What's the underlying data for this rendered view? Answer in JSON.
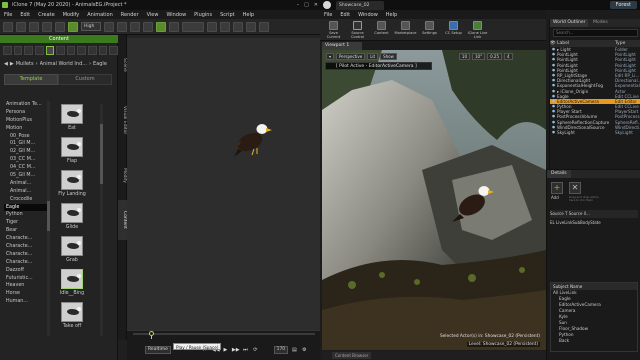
{
  "iclone": {
    "title": "iClone 7 (May 20 2020) - AnimalsEG.iProject *",
    "window_controls": [
      "–",
      "□",
      "✕"
    ],
    "menu": [
      "File",
      "Edit",
      "Create",
      "Modify",
      "Animation",
      "Render",
      "View",
      "Window",
      "Plugins",
      "Script",
      "Help"
    ],
    "toolbar_quality": "High",
    "content_title": "Content",
    "path_items": [
      "Mullets",
      "Animal World Ind...",
      "Eagle"
    ],
    "tabs": [
      "Template",
      "Custom"
    ],
    "tree": [
      "Animation Te...",
      "Persona",
      "MotionPlus",
      "Motion",
      "00_Pose",
      "01_Gll M...",
      "02_Gll M...",
      "03_CC M...",
      "04_CC M...",
      "05_Gll M...",
      "Animal...",
      "Animal...",
      "Crocodile",
      "Eagle",
      "Python",
      "Tiger",
      "Bear",
      "Characte...",
      "Characte...",
      "Characte...",
      "Characte...",
      "Dazzoff",
      "Futuristic...",
      "Heaven",
      "Horse",
      "Human..."
    ],
    "tree_selected_index": 13,
    "thumbs": [
      {
        "label": "Eat"
      },
      {
        "label": "Flap"
      },
      {
        "label": "Fly Landing"
      },
      {
        "label": "Glide"
      },
      {
        "label": "Grab"
      },
      {
        "label": "Idle__Bing"
      },
      {
        "label": "Take off"
      }
    ],
    "thumb_selected_index": 5,
    "side_tabs": [
      "Scene",
      "Visual Editor",
      "Modify",
      "Content"
    ],
    "timeline": {
      "mode": "Realtime",
      "tooltip": "Play / Pause (Space)",
      "frame": "170",
      "controls": [
        "⏮",
        "◀◀",
        "▶",
        "▶▶",
        "⏭",
        "⟳"
      ]
    }
  },
  "unreal": {
    "project": "Forest",
    "doc_tab": "Showcase_02",
    "menu": [
      "File",
      "Edit",
      "Window",
      "Help"
    ],
    "toolbar": [
      "Save Current",
      "Source Control",
      "Content",
      "Marketplace",
      "Settings",
      "CC Setup",
      "iClone Live Link"
    ],
    "viewport_tab": "Viewport 1",
    "viewport_bar": [
      "Perspective",
      "Lit",
      "Show",
      "10",
      "10°",
      "0.25",
      "4"
    ],
    "pilot_text": "[ Pilot Active - EditorActiveCamera ]",
    "status_selected": "Selected Actor(s) in: Showcase_02 (Persistent)",
    "status_level": "Level: Showcase_02 (Persistent)",
    "bottom_tab": "Content Browser",
    "outliner": {
      "tabs": [
        "World Outliner",
        "Modes"
      ],
      "search_placeholder": "Search...",
      "col_label": "Label",
      "col_type": "Type",
      "rows": [
        {
          "name": "▸ Light",
          "type": "Folder"
        },
        {
          "name": "  PointLight",
          "type": "PointLight"
        },
        {
          "name": "  PointLight",
          "type": "PointLight"
        },
        {
          "name": "  PointLight",
          "type": "PointLight"
        },
        {
          "name": "  PointLight",
          "type": "PointLight"
        },
        {
          "name": "  RP_LightStage",
          "type": "Edit RP_Li..."
        },
        {
          "name": "  DirectionalLight",
          "type": "Directional..."
        },
        {
          "name": "  ExponentialHeightFog",
          "type": "Exponential..."
        },
        {
          "name": "▸ iClone_Origin",
          "type": "Actor"
        },
        {
          "name": "  Eagle",
          "type": "Edit CCLive"
        },
        {
          "name": "  EditorActiveCamera",
          "type": "Edit Editor"
        },
        {
          "name": "  Python",
          "type": "Edit CCLive"
        },
        {
          "name": "  Player Start",
          "type": "PlayerStart"
        },
        {
          "name": "  PostProcessVolume",
          "type": "PostProcess..."
        },
        {
          "name": "  SphereReflectionCapture",
          "type": "SphereRefl..."
        },
        {
          "name": "  WindDirectionalSource",
          "type": "WindDirecti..."
        },
        {
          "name": "  SkyLight",
          "type": "SkyLight"
        }
      ],
      "selected_index": 10,
      "footer": "144 actors (1 selected)",
      "view_options": "View Options ▾"
    },
    "details": {
      "tab": "Details",
      "add_label": "Add",
      "remove_label": "✕",
      "hint": "Drag and drop actors here to link them",
      "source_header": "Source T  Source ll...",
      "source_value": "EL LiveLinkSubBodyState",
      "table_header": "Subject Name",
      "table_rows": [
        "All LiveLink",
        "Eagle",
        "EditorActiveCamera",
        "Camera",
        "Kyle",
        "Sun",
        "Floor_Shadow",
        "Python",
        "Back"
      ]
    }
  }
}
